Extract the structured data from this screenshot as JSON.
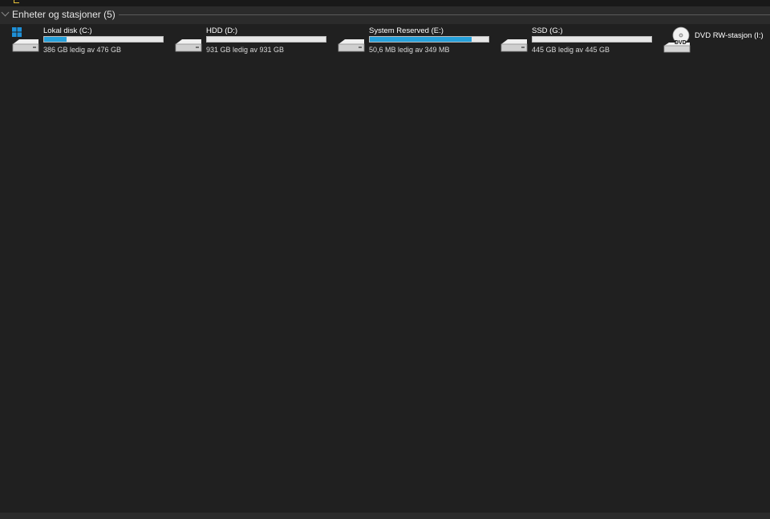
{
  "group": {
    "title": "Enheter og stasjoner (5)"
  },
  "drives": [
    {
      "name": "Lokal disk (C:)",
      "free_text": "386 GB ledig av 476 GB",
      "used_fraction": 0.19,
      "icon": "windows-hdd-icon"
    },
    {
      "name": "HDD (D:)",
      "free_text": "931 GB ledig av 931 GB",
      "used_fraction": 0.0,
      "icon": "hdd-icon"
    },
    {
      "name": "System Reserved (E:)",
      "free_text": "50,6 MB ledig av 349 MB",
      "used_fraction": 0.855,
      "icon": "hdd-icon"
    },
    {
      "name": "SSD (G:)",
      "free_text": "445 GB ledig av 445 GB",
      "used_fraction": 0.0,
      "icon": "hdd-icon"
    }
  ],
  "dvd": {
    "name": "DVD RW-stasjon (I:)",
    "icon": "dvd-drive-icon",
    "label": "DVD"
  },
  "colors": {
    "background": "#202020",
    "header": "#2b2b2b",
    "bar_fill": "#26a0da",
    "bar_empty": "#e6e6e6"
  }
}
